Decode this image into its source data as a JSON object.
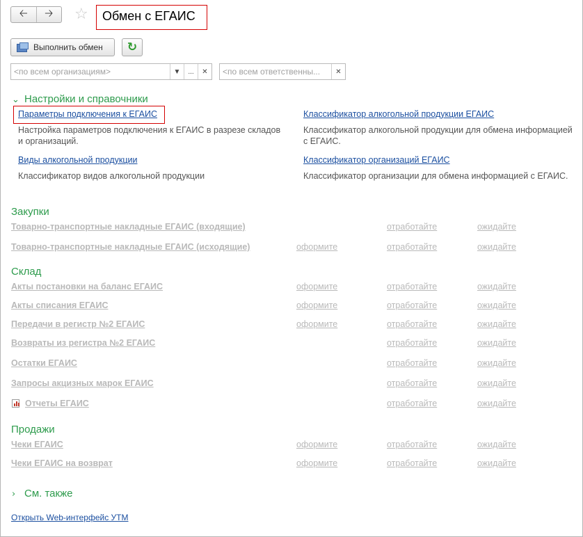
{
  "window": {
    "title": "Обмен с ЕГАИС",
    "nav_back_icon": "arrow-left-icon",
    "nav_forward_icon": "arrow-right-icon",
    "favorite_icon": "star-icon"
  },
  "toolbar": {
    "exchange_label": "Выполнить обмен",
    "refresh_icon": "refresh-icon"
  },
  "filters": {
    "organization_placeholder": "<по всем организациям>",
    "responsible_placeholder": "<по всем ответственны..."
  },
  "settings": {
    "title": "Настройки и справочники",
    "items": [
      {
        "link": "Параметры подключения к ЕГАИС",
        "desc_line1": "Настройка параметров подключения к ЕГАИС в разрезе складов",
        "desc_line2": "и организаций."
      },
      {
        "link": "Классификатор алкогольной продукции ЕГАИС",
        "desc_line1": "Классификатор алкогольной продукции для обмена информацией",
        "desc_line2": "с ЕГАИС."
      },
      {
        "link": "Виды алкогольной продукции",
        "desc_line1": "Классификатор видов алкогольной продукции",
        "desc_line2": ""
      },
      {
        "link": "Классификатор организаций ЕГАИС",
        "desc_line1": "Классификатор организации для обмена информацией с ЕГАИС.",
        "desc_line2": ""
      }
    ]
  },
  "purchases": {
    "title": "Закупки",
    "rows": [
      {
        "label": "Товарно-транспортные накладные ЕГАИС (входящие)",
        "c1": "",
        "c2": "отработайте",
        "c3": "ожидайте"
      },
      {
        "label": "Товарно-транспортные накладные ЕГАИС (исходящие)",
        "c1": "оформите",
        "c2": "отработайте",
        "c3": "ожидайте"
      }
    ]
  },
  "warehouse": {
    "title": "Склад",
    "rows": [
      {
        "label": "Акты постановки на баланс ЕГАИС",
        "c1": "оформите",
        "c2": "отработайте",
        "c3": "ожидайте"
      },
      {
        "label": "Акты списания ЕГАИС",
        "c1": "оформите",
        "c2": "отработайте",
        "c3": "ожидайте"
      },
      {
        "label": "Передачи в регистр №2 ЕГАИС",
        "c1": "оформите",
        "c2": "отработайте",
        "c3": "ожидайте"
      },
      {
        "label": "Возвраты из регистра №2 ЕГАИС",
        "c1": "",
        "c2": "отработайте",
        "c3": "ожидайте"
      },
      {
        "label": "Остатки ЕГАИС",
        "c1": "",
        "c2": "отработайте",
        "c3": "ожидайте"
      },
      {
        "label": "Запросы акцизных марок ЕГАИС",
        "c1": "",
        "c2": "отработайте",
        "c3": "ожидайте"
      },
      {
        "label": "Отчеты ЕГАИС",
        "c1": "",
        "c2": "отработайте",
        "c3": "ожидайте"
      }
    ]
  },
  "sales": {
    "title": "Продажи",
    "rows": [
      {
        "label": "Чеки ЕГАИС",
        "c1": "оформите",
        "c2": "отработайте",
        "c3": "ожидайте"
      },
      {
        "label": "Чеки ЕГАИС на возврат",
        "c1": "оформите",
        "c2": "отработайте",
        "c3": "ожидайте"
      }
    ]
  },
  "see_also": {
    "title": "См. также"
  },
  "footer": {
    "utm_link": "Открыть Web-интерфейс УТМ"
  },
  "colors": {
    "section_green": "#2d9b4c",
    "link_blue": "#1b4fa0",
    "disabled_gray": "#b9b9b9",
    "highlight_red": "#d40000"
  }
}
